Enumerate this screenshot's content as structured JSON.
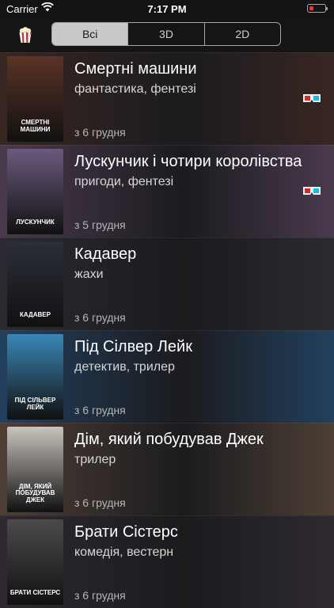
{
  "status": {
    "carrier": "Carrier",
    "time": "7:17 PM"
  },
  "nav": {
    "app_icon": "popcorn-icon",
    "segments": [
      "Всі",
      "3D",
      "2D"
    ],
    "selected_segment": "Всі"
  },
  "movies": [
    {
      "title": "Смертні машини",
      "genre": "фантастика, фентезі",
      "date": "з 6 грудня",
      "is_3d": true,
      "poster_text": "СМЕРТНІ МАШИНИ",
      "colors": {
        "bg": "#382622",
        "poster": "#5a3325"
      }
    },
    {
      "title": "Лускунчик і чотири королівства",
      "genre": "пригоди, фентезі",
      "date": "з 5 грудня",
      "is_3d": true,
      "poster_text": "ЛУСКУНЧИК",
      "colors": {
        "bg": "#4a3a4e",
        "poster": "#6a5a7e"
      }
    },
    {
      "title": "Кадавер",
      "genre": "жахи",
      "date": "з 6 грудня",
      "is_3d": false,
      "poster_text": "КАДАВЕР",
      "colors": {
        "bg": "#2a2a30",
        "poster": "#2b2f3a"
      }
    },
    {
      "title": "Під Сілвер Лейк",
      "genre": "детектив, трилер",
      "date": "з 6 грудня",
      "is_3d": false,
      "poster_text": "ПІД СІЛЬВЕР ЛЕЙК",
      "colors": {
        "bg": "#22405e",
        "poster": "#3a86b6"
      }
    },
    {
      "title": "Дім, який побудував Джек",
      "genre": "трилер",
      "date": "з 6 грудня",
      "is_3d": false,
      "poster_text": "ДІМ, ЯКИЙ ПОБУДУВАВ ДЖЕК",
      "colors": {
        "bg": "#4e3f36",
        "poster": "#c9c4bd"
      }
    },
    {
      "title": "Брати Сістерс",
      "genre": "комедія, вестерн",
      "date": "з 6 грудня",
      "is_3d": false,
      "poster_text": "БРАТИ СІСТЕРС",
      "colors": {
        "bg": "#2e2a30",
        "poster": "#4a4a4a"
      }
    }
  ]
}
